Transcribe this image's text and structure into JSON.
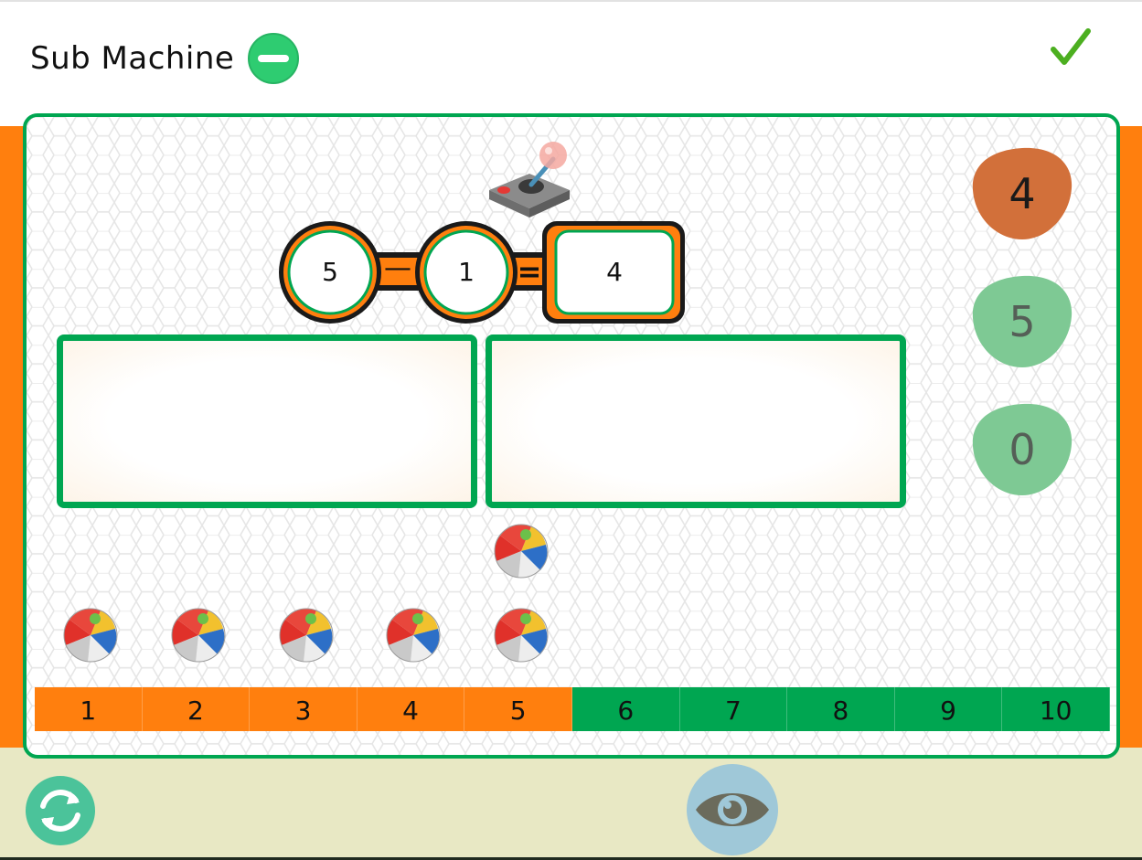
{
  "app": {
    "title": "Sub Machine",
    "title_icon": "minus-circle-icon"
  },
  "colors": {
    "accent_green": "#00a651",
    "accent_orange": "#ff7f0e",
    "selected_choice": "#d2703a",
    "choice_green": "#7ec994",
    "bottom_bg": "#e8e8c4"
  },
  "equation": {
    "minuend": "5",
    "operator": "—",
    "subtrahend": "1",
    "equals": "=",
    "result": "4"
  },
  "choices": [
    {
      "label": "4",
      "state": "selected-correct"
    },
    {
      "label": "5",
      "state": "available"
    },
    {
      "label": "0",
      "state": "available"
    }
  ],
  "balls": {
    "count": 5,
    "lifted": 1,
    "icon": "beach-ball-icon"
  },
  "number_line": {
    "cells": [
      "1",
      "2",
      "3",
      "4",
      "5",
      "6",
      "7",
      "8",
      "9",
      "10"
    ],
    "highlighted_up_to": 5
  },
  "controls": {
    "reset_icon": "refresh-icon",
    "reveal_icon": "eye-icon"
  }
}
